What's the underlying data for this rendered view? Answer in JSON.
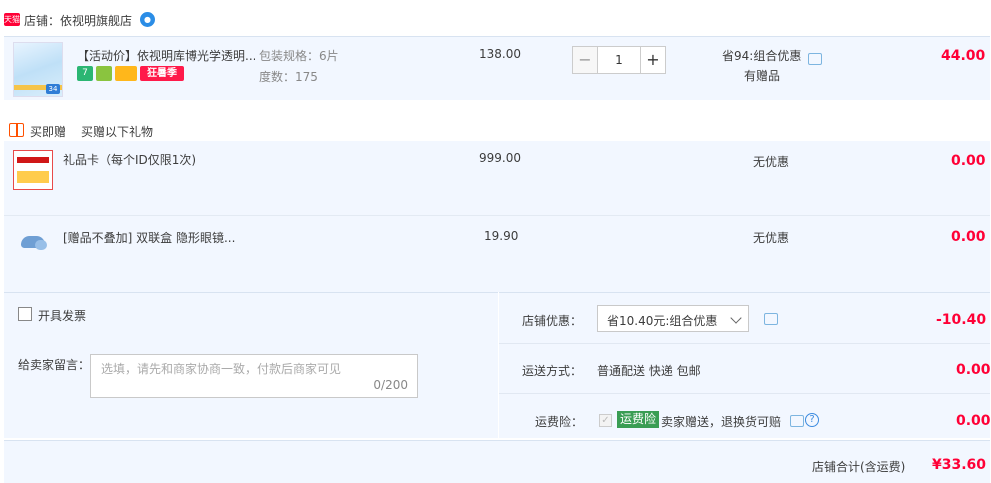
{
  "shop": {
    "badge": "天猫",
    "label": "店铺：依视明旗舰店",
    "ww_icon": "chat-bubble-icon"
  },
  "main_item": {
    "title": "【活动价】依视明库博光学透明...",
    "thumb_badge": "34",
    "tags": {
      "t7": "7",
      "tt": "",
      "tc": "",
      "sale": "狂暑季"
    },
    "spec1": "包装规格：6片",
    "spec2": "度数：175",
    "unit_price": "138.00",
    "quantity": "1",
    "qty_minus": "−",
    "qty_plus": "+",
    "promo": "省94:组合优惠",
    "gift_note": "有赠品",
    "amount": "44.00"
  },
  "gift_section": {
    "header": "买即赠",
    "sub_header": "买赠以下礼物",
    "items": [
      {
        "title": "礼品卡（每个ID仅限1次)",
        "price": "999.00",
        "promo": "无优惠",
        "amount": "0.00"
      },
      {
        "title": "[赠品不叠加] 双联盒 隐形眼镜...",
        "price": "19.90",
        "promo": "无优惠",
        "amount": "0.00"
      }
    ]
  },
  "invoice": {
    "label": "开具发票"
  },
  "message": {
    "label": "给卖家留言：",
    "placeholder": "选填，请先和商家协商一致，付款后商家可见",
    "count": "0/200"
  },
  "discount": {
    "label": "店铺优惠：",
    "selected": "省10.40元:组合优惠",
    "amount": "-10.40"
  },
  "shipping": {
    "label": "运送方式：",
    "value": "普通配送 快递 包邮",
    "amount": "0.00"
  },
  "insurance": {
    "label": "运费险：",
    "tag": "运费险",
    "desc": "卖家赠送，退换货可赔",
    "help": "?",
    "amount": "0.00"
  },
  "total": {
    "label": "店铺合计(含运费)",
    "amount": "¥33.60"
  },
  "colors": {
    "accent_red": "#ff0036",
    "row_bg": "#f2f7ff",
    "tmall_red": "#ff0036",
    "insurance_green": "#3a9d54"
  }
}
